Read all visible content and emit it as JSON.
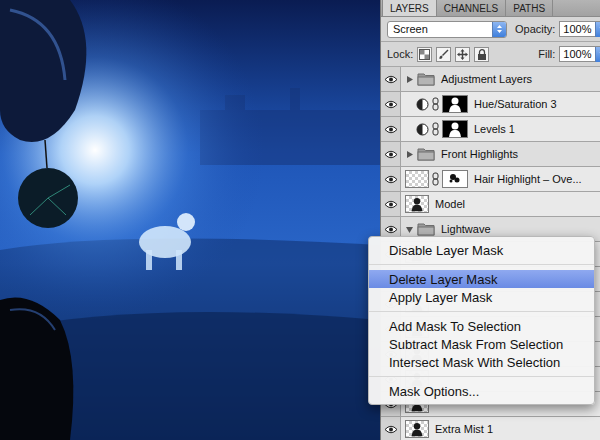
{
  "panel": {
    "tabs": [
      {
        "label": "LAYERS",
        "selected": true
      },
      {
        "label": "CHANNELS",
        "selected": false
      },
      {
        "label": "PATHS",
        "selected": false
      }
    ],
    "blend_mode": "Screen",
    "opacity": {
      "label": "Opacity:",
      "value": "100%"
    },
    "lock": {
      "label": "Lock:"
    },
    "fill": {
      "label": "Fill:",
      "value": "100%"
    },
    "layers": [
      {
        "name": "Adjustment Layers",
        "kind": "folder",
        "visible": true,
        "expanded": false
      },
      {
        "name": "Hue/Saturation 3",
        "kind": "adjustment",
        "visible": true
      },
      {
        "name": "Levels 1",
        "kind": "adjustment",
        "visible": true
      },
      {
        "name": "Front Highlights",
        "kind": "folder",
        "visible": true,
        "expanded": false
      },
      {
        "name": "Hair Highlight – Ove...",
        "kind": "masked",
        "visible": true
      },
      {
        "name": "Model",
        "kind": "pixel",
        "visible": true
      },
      {
        "name": "Lightwave",
        "kind": "folder",
        "visible": true,
        "expanded": true
      },
      {
        "name": "",
        "kind": "pixel",
        "visible": true
      },
      {
        "name": "",
        "kind": "pixel",
        "visible": true
      },
      {
        "name": "",
        "kind": "pixel",
        "visible": true
      },
      {
        "name": "",
        "kind": "pixel",
        "visible": true
      },
      {
        "name": "",
        "kind": "pixel",
        "visible": true
      },
      {
        "name": "",
        "kind": "pixel",
        "visible": true
      },
      {
        "name": "",
        "kind": "pixel",
        "visible": true
      },
      {
        "name": "Extra Mist 1",
        "kind": "pixel",
        "visible": true
      }
    ]
  },
  "context_menu": {
    "groups": [
      [
        {
          "label": "Disable Layer Mask",
          "selected": false
        }
      ],
      [
        {
          "label": "Delete Layer Mask",
          "selected": true
        },
        {
          "label": "Apply Layer Mask",
          "selected": false
        }
      ],
      [
        {
          "label": "Add Mask To Selection",
          "selected": false
        },
        {
          "label": "Subtract Mask From Selection",
          "selected": false
        },
        {
          "label": "Intersect Mask With Selection",
          "selected": false
        }
      ],
      [
        {
          "label": "Mask Options...",
          "selected": false
        }
      ]
    ]
  }
}
